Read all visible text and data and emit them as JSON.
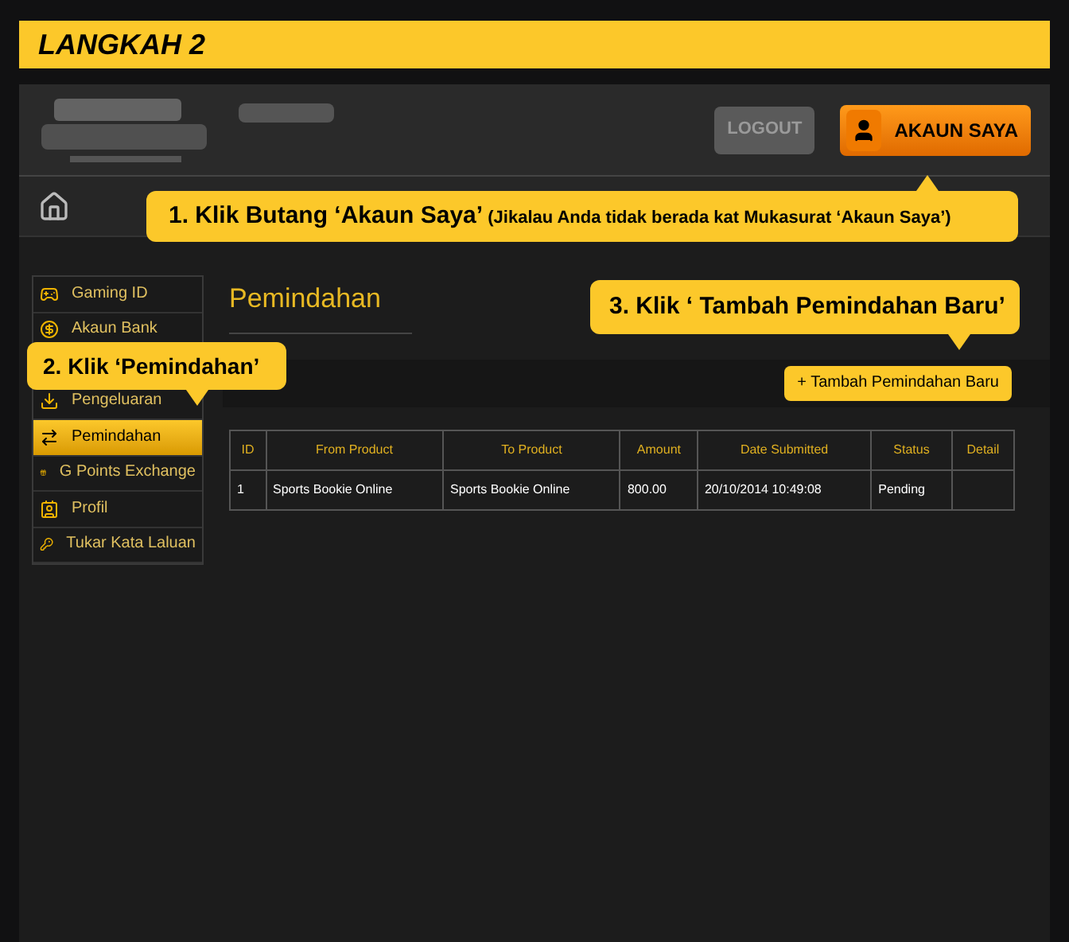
{
  "step_title": "LANGKAH 2",
  "header": {
    "logout": "LOGOUT",
    "account_button": "AKAUN SAYA"
  },
  "sidebar": {
    "items": [
      {
        "label": "Gaming ID",
        "selected": false
      },
      {
        "label": "Akaun Bank",
        "selected": false
      },
      {
        "label": "Pengeluaran",
        "selected": false
      },
      {
        "label": "Pemindahan",
        "selected": true
      },
      {
        "label": "G Points Exchange",
        "selected": false
      },
      {
        "label": "Profil",
        "selected": false
      },
      {
        "label": "Tukar Kata Laluan",
        "selected": false
      }
    ]
  },
  "page_title": "Pemindahan",
  "add_button": "+ Tambah Pemindahan Baru",
  "table": {
    "columns": [
      "ID",
      "From Product",
      "To Product",
      "Amount",
      "Date Submitted",
      "Status",
      "Detail"
    ],
    "rows": [
      [
        "1",
        "Sports Bookie Online",
        "Sports Bookie Online",
        "800.00",
        "20/10/2014 10:49:08",
        "Pending",
        ""
      ]
    ]
  },
  "callouts": [
    {
      "lead": "1. Klik Butang ‘Akaun Saya’",
      "note": "(Jikalau Anda tidak berada kat Mukasurat ‘Akaun Saya’)"
    },
    {
      "lead": "2. Klik ‘Pemindahan’"
    },
    {
      "lead": "3. Klik ‘ Tambah Pemindahan Baru’"
    }
  ]
}
